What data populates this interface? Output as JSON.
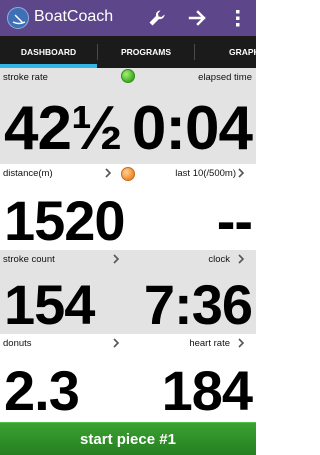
{
  "app": {
    "title": "BoatCoach"
  },
  "tabs": [
    {
      "label": "DASHBOARD"
    },
    {
      "label": "PROGRAMS"
    },
    {
      "label": "GRAPH"
    }
  ],
  "stats": {
    "stroke_rate": {
      "label": "stroke rate",
      "value": "42½"
    },
    "elapsed_time": {
      "label": "elapsed time",
      "value": "0:04"
    },
    "distance": {
      "label": "distance(m)",
      "value": "1520"
    },
    "last10": {
      "label": "last 10(/500m)",
      "value": "--"
    },
    "stroke_count": {
      "label": "stroke count",
      "value": "154"
    },
    "clock": {
      "label": "clock",
      "value": "7:36"
    },
    "donuts": {
      "label": "donuts",
      "value": "2.3"
    },
    "heart_rate": {
      "label": "heart rate",
      "value": "184"
    }
  },
  "indicators": {
    "top": "green",
    "middle": "orange"
  },
  "colors": {
    "actionbar": "#5d468a",
    "tab_indicator": "#33b5e5",
    "start_button": "#2e8f27"
  },
  "start_button": {
    "label": "start piece #1"
  }
}
